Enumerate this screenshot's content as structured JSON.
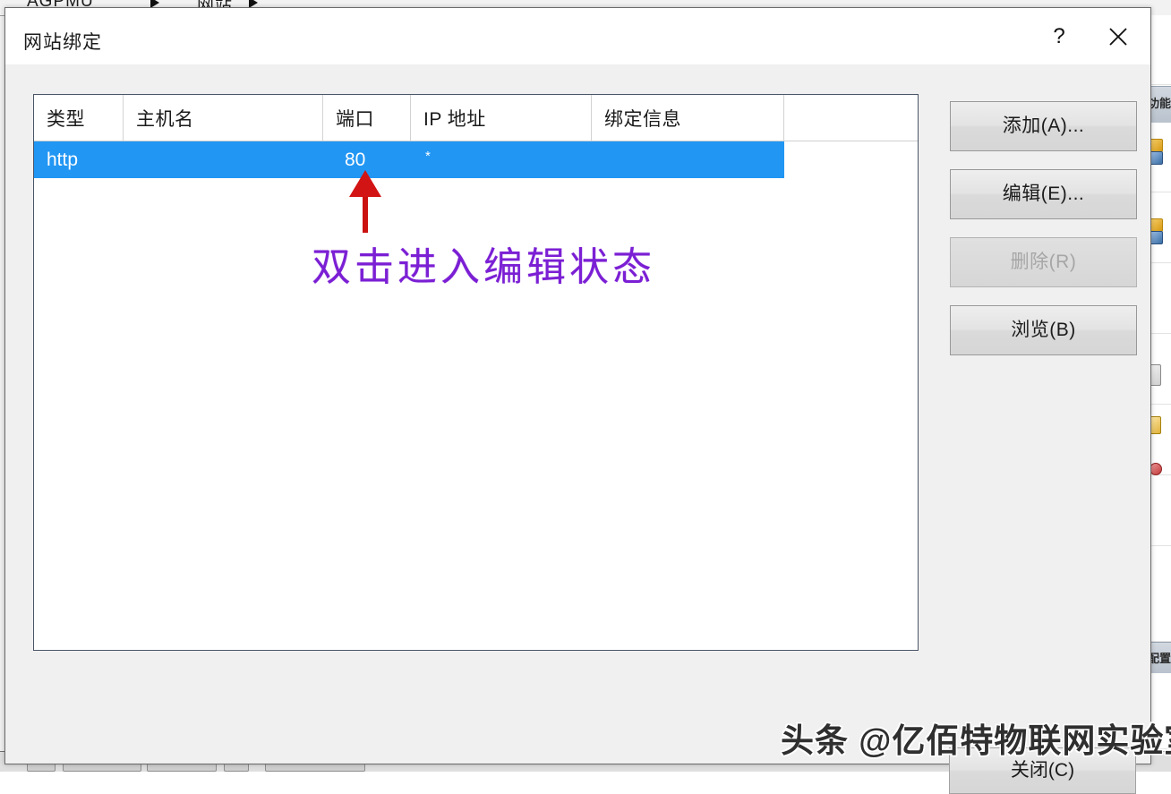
{
  "background": {
    "breadcrumb_text": "AGPMU",
    "breadcrumb_text_2": "网站",
    "right_panel_label": "功能",
    "right_panel_label_2": "配置"
  },
  "dialog": {
    "title": "网站绑定",
    "help_label": "?",
    "close_label": "✕"
  },
  "table": {
    "columns": [
      {
        "key": "type",
        "label": "类型"
      },
      {
        "key": "hostname",
        "label": "主机名"
      },
      {
        "key": "port",
        "label": "端口"
      },
      {
        "key": "ip",
        "label": "IP 地址"
      },
      {
        "key": "binding",
        "label": "绑定信息"
      }
    ],
    "rows": [
      {
        "type": "http",
        "hostname": "",
        "port": "80",
        "ip": "*",
        "binding": "",
        "selected": true
      }
    ]
  },
  "buttons": {
    "add": "添加(A)...",
    "edit": "编辑(E)...",
    "remove": "删除(R)",
    "browse": "浏览(B)",
    "close": "关闭(C)"
  },
  "annotation": {
    "text": "双击进入编辑状态",
    "text_color": "#7b1fd4",
    "arrow_color": "#cc1111"
  },
  "watermark": {
    "text": "头条 @亿佰特物联网实验室"
  },
  "colors": {
    "selection": "#2196f3",
    "dialog_bg": "#f0f0f0",
    "titlebar_bg": "#ffffff",
    "listview_border": "#4a5568"
  }
}
